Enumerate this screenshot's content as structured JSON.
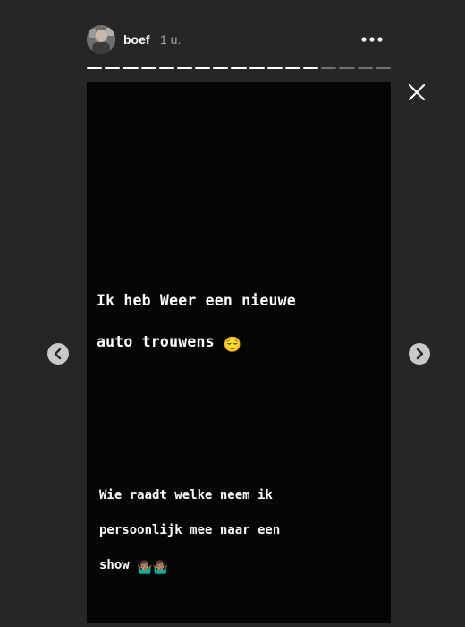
{
  "header": {
    "username": "boef",
    "timestamp": "1 u."
  },
  "progress": {
    "segments_total": 17,
    "segments_viewed": 13,
    "current_fill": 1.0
  },
  "story": {
    "text_1_line_1": "Ik heb Weer een nieuwe",
    "text_1_line_2": "auto trouwens",
    "text_1_emoji": "😌",
    "text_2_line_1": "Wie raadt welke neem ik",
    "text_2_line_2": "persoonlijk mee naar een",
    "text_2_line_3": "show",
    "text_2_emoji": "🤷🏽‍♂️🤷🏽‍♂️"
  },
  "icons": {
    "more": "more-options-icon",
    "close": "close-icon",
    "prev": "chevron-left-icon",
    "next": "chevron-right-icon"
  },
  "colors": {
    "background": "#262626",
    "story_background": "#050505",
    "text": "#ffffff",
    "timestamp": "#a8a8a8"
  }
}
